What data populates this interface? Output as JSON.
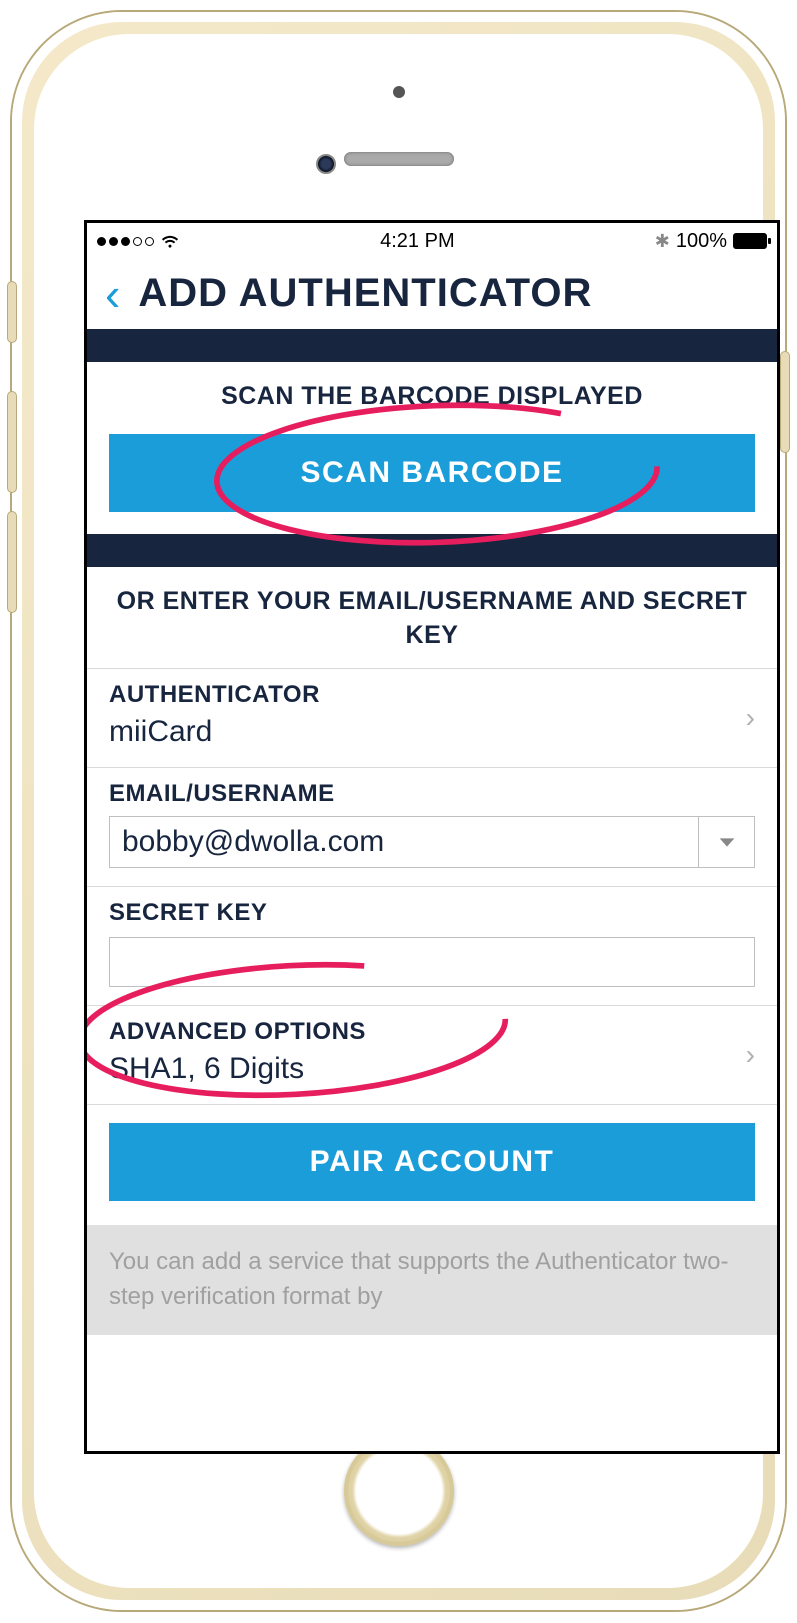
{
  "statusbar": {
    "time": "4:21 PM",
    "battery_text": "100%"
  },
  "nav": {
    "title": "ADD AUTHENTICATOR"
  },
  "scan": {
    "heading": "SCAN THE BARCODE DISPLAYED",
    "button": "SCAN BARCODE"
  },
  "manual": {
    "heading": "OR ENTER YOUR EMAIL/USERNAME AND SECRET KEY"
  },
  "authenticator": {
    "label": "AUTHENTICATOR",
    "value": "miiCard"
  },
  "email": {
    "label": "EMAIL/USERNAME",
    "value": "bobby@dwolla.com"
  },
  "secret": {
    "label": "SECRET KEY",
    "value": ""
  },
  "advanced": {
    "label": "ADVANCED OPTIONS",
    "value": "SHA1, 6 Digits"
  },
  "pair": {
    "button": "PAIR ACCOUNT"
  },
  "footer": {
    "text": "You can add a service that supports the Authenticator two-step verification format by"
  }
}
